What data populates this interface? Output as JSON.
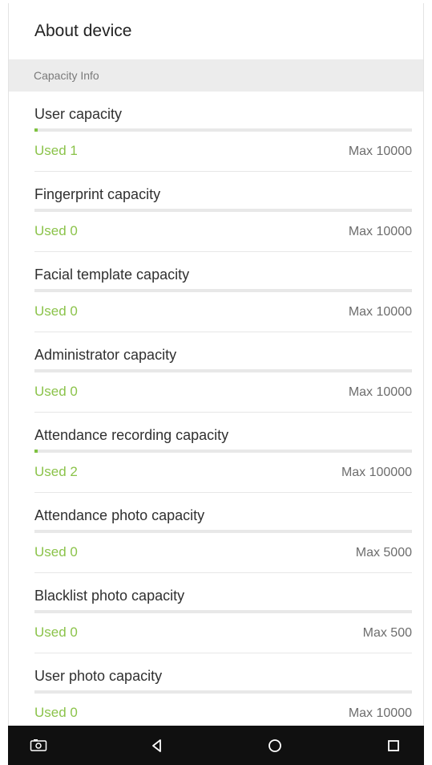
{
  "header": {
    "title": "About device"
  },
  "section": {
    "title": "Capacity Info"
  },
  "items": [
    {
      "label": "User capacity",
      "used": "Used 1",
      "max": "Max 10000",
      "usage_fraction": 0.0001
    },
    {
      "label": "Fingerprint capacity",
      "used": "Used 0",
      "max": "Max 10000",
      "usage_fraction": 0
    },
    {
      "label": "Facial template capacity",
      "used": "Used 0",
      "max": "Max 10000",
      "usage_fraction": 0
    },
    {
      "label": "Administrator capacity",
      "used": "Used 0",
      "max": "Max 10000",
      "usage_fraction": 0
    },
    {
      "label": "Attendance recording capacity",
      "used": "Used 2",
      "max": "Max 100000",
      "usage_fraction": 2e-05
    },
    {
      "label": "Attendance photo capacity",
      "used": "Used 0",
      "max": "Max 5000",
      "usage_fraction": 0
    },
    {
      "label": "Blacklist photo capacity",
      "used": "Used 0",
      "max": "Max 500",
      "usage_fraction": 0
    },
    {
      "label": "User photo capacity",
      "used": "Used 0",
      "max": "Max 10000",
      "usage_fraction": 0
    }
  ],
  "navbar": {
    "icons": [
      "screenshot-icon",
      "back-icon",
      "home-icon",
      "recent-apps-icon"
    ]
  },
  "colors": {
    "accent": "#8bc34a",
    "bar_fill": "#7fc241",
    "navbar": "#101010"
  }
}
